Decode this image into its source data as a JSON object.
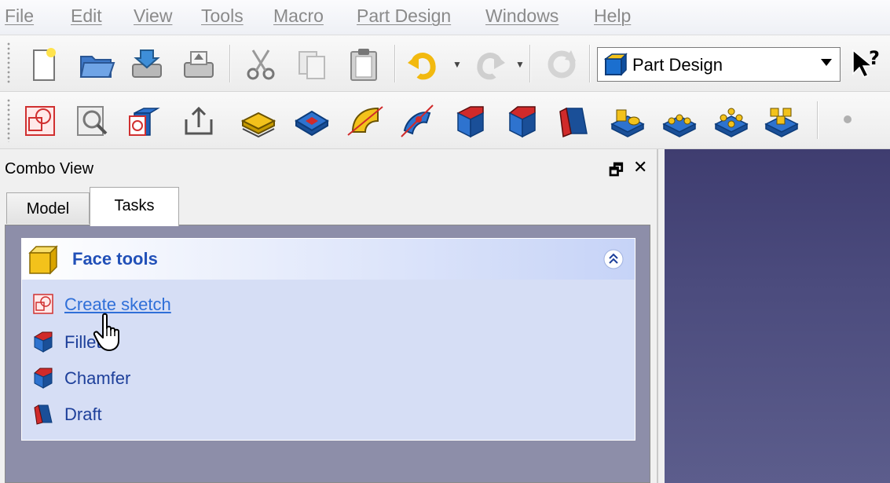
{
  "menu": [
    "File",
    "Edit",
    "View",
    "Tools",
    "Macro",
    "Part Design",
    "Windows",
    "Help"
  ],
  "workbench": {
    "selected": "Part Design"
  },
  "combo_view": {
    "title": "Combo View",
    "float_glyph": "🗗",
    "close_glyph": "✕",
    "tabs": [
      "Model",
      "Tasks"
    ],
    "active_tab": "Tasks"
  },
  "task_panel": {
    "title": "Face tools",
    "items": [
      {
        "label": "Create sketch",
        "icon": "sketch-icon"
      },
      {
        "label": "Fillet",
        "icon": "fillet-icon"
      },
      {
        "label": "Chamfer",
        "icon": "chamfer-icon"
      },
      {
        "label": "Draft",
        "icon": "draft-icon"
      }
    ]
  },
  "colors": {
    "link": "#2f6fd8",
    "panel_title": "#2150b8",
    "view_background": "#45457a",
    "task_area": "#8d8ea9"
  }
}
